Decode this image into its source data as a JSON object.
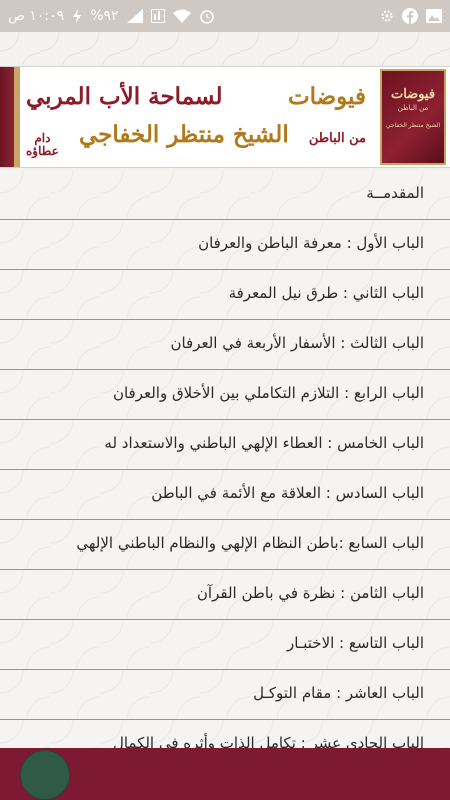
{
  "status_bar": {
    "time": "١٠:٠٩ ص",
    "battery": "%٩٢",
    "icons_left": [
      "gear-icon",
      "facebook-icon",
      "gallery-icon"
    ],
    "icons_right": [
      "charging-icon",
      "signal-icon",
      "data-icon",
      "wifi-icon",
      "alarm-icon"
    ]
  },
  "banner": {
    "word_fuyudat": "فيوضات",
    "word_lisamahat": "لسماحة الأب المربي",
    "word_min_albatin": "من الباطن",
    "word_sheikh": "الشيخ منتظر الخفاجي",
    "word_dam": "دام",
    "word_itaah": "عطاؤه",
    "book_title": "فيوضات",
    "book_subtitle": "من الباطن",
    "book_author": "الشيخ منتظر الخفاجي"
  },
  "chapters": [
    "المقدمــة",
    "الباب الأول : معرفة الباطن والعرفان",
    "الباب الثاني : طرق نيل المعرفة",
    "الباب الثالث : الأسفار الأربعة في العرفان",
    "الباب الرابع : التلازم التكاملي بين الأخلاق والعرفان",
    "الباب الخامس : العطاء الإلهي الباطني والاستعداد له",
    "الباب السادس : العلاقة مع الأئمة في الباطن",
    "الباب  السابع :باطن النظام الإلهي والنظام الباطني الإلهي",
    "الباب الثامن : نظرة في باطن القرآن",
    "الباب التاسع : الاختبـار",
    "الباب العاشر : مقام التوكـل",
    "الباب الحادي عشر : تكامل الذات وأثره في الكمال"
  ],
  "colors": {
    "maroon": "#7d1931",
    "gold": "#b07a1c",
    "fab": "#2f5a44"
  }
}
